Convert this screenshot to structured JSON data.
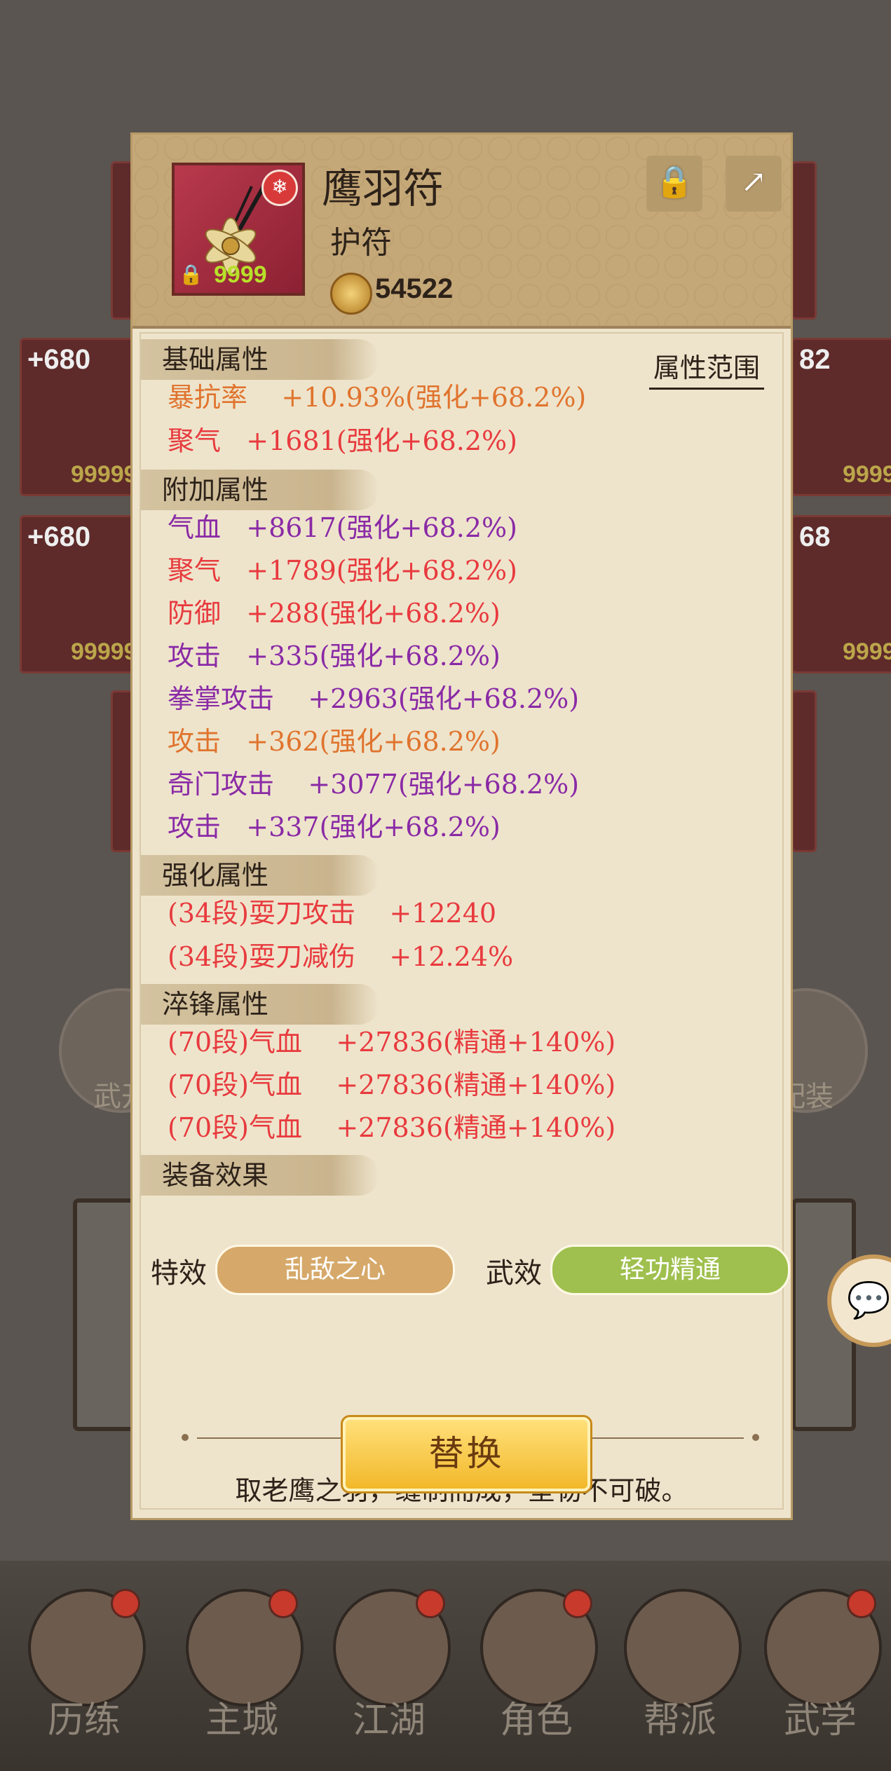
{
  "background": {
    "cards_left": [
      {
        "plus": "+680",
        "gold": "99999"
      },
      {
        "plus": "+680",
        "gold": "99999"
      }
    ],
    "cards_right": [
      {
        "plus": "82",
        "gold": "9999"
      },
      {
        "plus": "68",
        "gold": "9999"
      }
    ],
    "circle_left": "武开",
    "circle_right": "配装"
  },
  "bottom_nav": [
    {
      "label": "历练"
    },
    {
      "label": "主城"
    },
    {
      "label": "江湖"
    },
    {
      "label": "角色"
    },
    {
      "label": "帮派"
    },
    {
      "label": "武学"
    }
  ],
  "item": {
    "name": "鹰羽符",
    "type": "护符",
    "power": "54522",
    "icon_gold": "9999"
  },
  "range_button": "属性范围",
  "sections": {
    "base": {
      "title": "基础属性",
      "rows": [
        {
          "text": "暴抗率    +10.93%(强化+68.2%)",
          "color": "orange"
        },
        {
          "text": "聚气   +1681(强化+68.2%)",
          "color": "red"
        }
      ]
    },
    "extra": {
      "title": "附加属性",
      "rows": [
        {
          "text": "气血   +8617(强化+68.2%)",
          "color": "purple"
        },
        {
          "text": "聚气   +1789(强化+68.2%)",
          "color": "red"
        },
        {
          "text": "防御   +288(强化+68.2%)",
          "color": "red"
        },
        {
          "text": "攻击   +335(强化+68.2%)",
          "color": "purple"
        },
        {
          "text": "拳掌攻击    +2963(强化+68.2%)",
          "color": "purple"
        },
        {
          "text": "攻击   +362(强化+68.2%)",
          "color": "orange"
        },
        {
          "text": "奇门攻击    +3077(强化+68.2%)",
          "color": "purple"
        },
        {
          "text": "攻击   +337(强化+68.2%)",
          "color": "purple"
        }
      ]
    },
    "enhance": {
      "title": "强化属性",
      "rows": [
        {
          "text": "(34段)耍刀攻击    +12240",
          "color": "red"
        },
        {
          "text": "(34段)耍刀减伤    +12.24%",
          "color": "red"
        }
      ]
    },
    "temper": {
      "title": "淬锋属性",
      "rows": [
        {
          "text": "(70段)气血    +27836(精通+140%)",
          "color": "red"
        },
        {
          "text": "(70段)气血    +27836(精通+140%)",
          "color": "red"
        },
        {
          "text": "(70段)气血    +27836(精通+140%)",
          "color": "red"
        }
      ]
    },
    "effect": {
      "title": "装备效果"
    }
  },
  "effects": {
    "special_label": "特效",
    "special_value": "乱敌之心",
    "wu_label": "武效",
    "wu_value": "轻功精通"
  },
  "description": "取老鹰之羽，缝制而成，坚韧不可破。",
  "replace_button": "替换",
  "colors": {
    "orange": "#e0742e",
    "red": "#e83a3e",
    "purple": "#8a2aa6"
  }
}
